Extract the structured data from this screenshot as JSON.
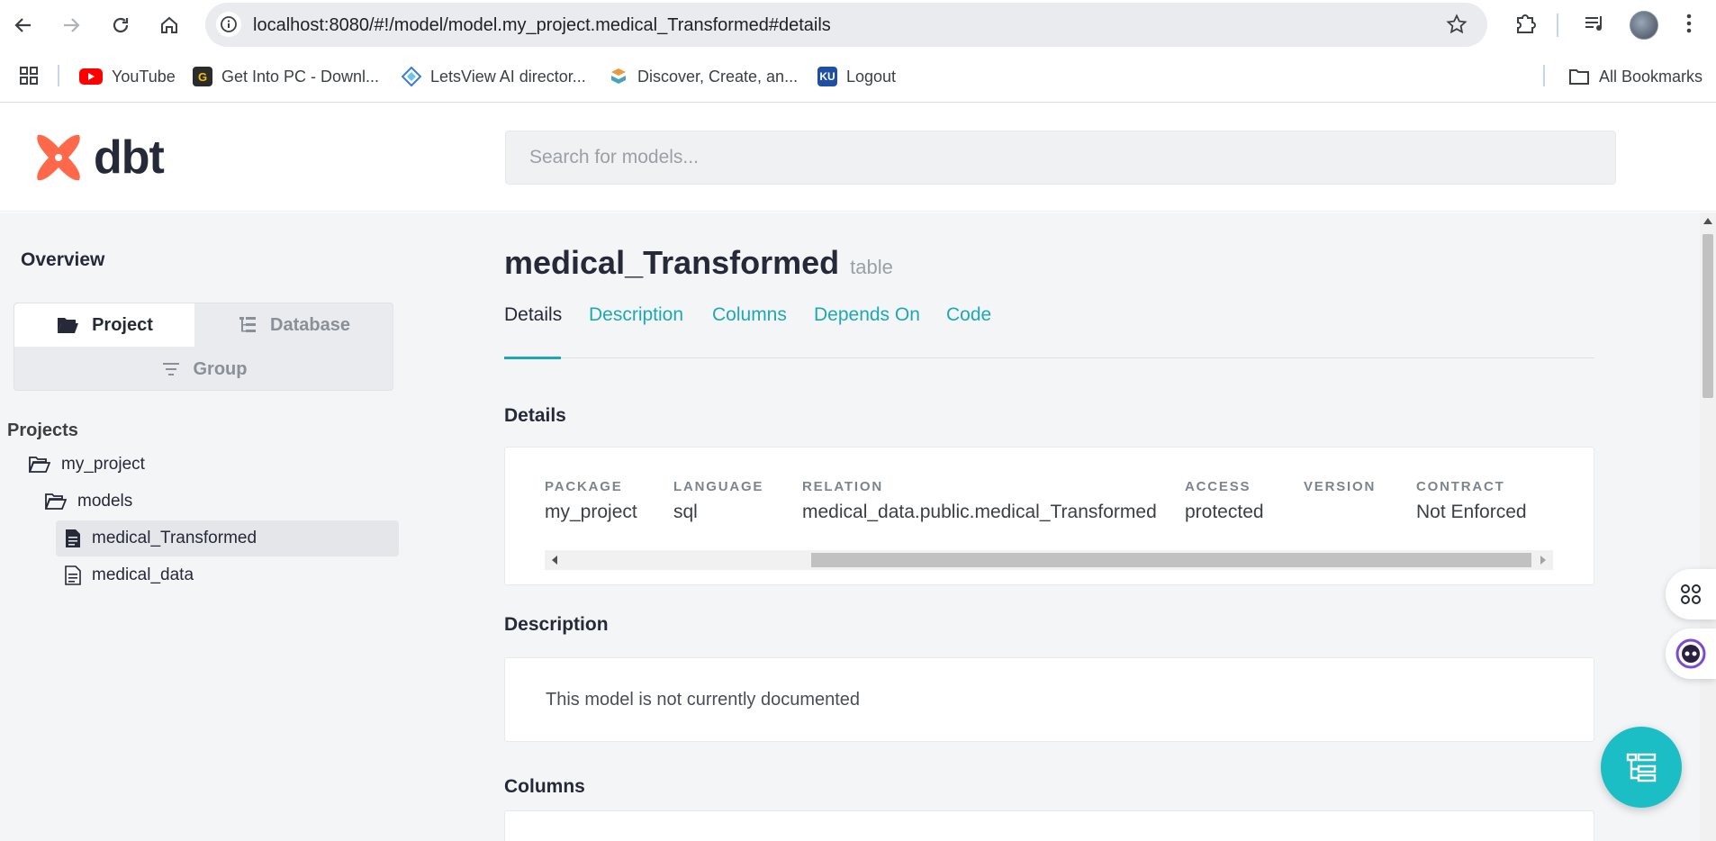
{
  "browser": {
    "url": "localhost:8080/#!/model/model.my_project.medical_Transformed#details",
    "bookmarks": [
      {
        "label": "YouTube",
        "icon": "youtube-icon"
      },
      {
        "label": "Get Into PC - Downl...",
        "icon": "getintopc-icon"
      },
      {
        "label": "LetsView AI director...",
        "icon": "letsview-icon"
      },
      {
        "label": "Discover, Create, an...",
        "icon": "discover-icon"
      },
      {
        "label": "Logout",
        "icon": "ku-icon",
        "icon_text": "KU"
      }
    ],
    "all_bookmarks": "All Bookmarks"
  },
  "app": {
    "logo_text": "dbt",
    "search_placeholder": "Search for models...",
    "accent_color": "#1da8b4",
    "brand_color": "#ff694a"
  },
  "sidebar": {
    "overview": "Overview",
    "tabs": {
      "project": "Project",
      "database": "Database",
      "group": "Group"
    },
    "active_tab": "Project",
    "projects_label": "Projects",
    "tree": {
      "project": "my_project",
      "folder": "models",
      "items": [
        {
          "label": "medical_Transformed",
          "selected": true
        },
        {
          "label": "medical_data",
          "selected": false
        }
      ]
    }
  },
  "model": {
    "name": "medical_Transformed",
    "kind": "table",
    "tabs": [
      "Details",
      "Description",
      "Columns",
      "Depends On",
      "Code"
    ],
    "active_tab": "Details",
    "details_title": "Details",
    "details": [
      {
        "key": "PACKAGE",
        "value": "my_project"
      },
      {
        "key": "LANGUAGE",
        "value": "sql"
      },
      {
        "key": "RELATION",
        "value": "medical_data.public.medical_Transformed"
      },
      {
        "key": "ACCESS",
        "value": "protected"
      },
      {
        "key": "VERSION",
        "value": ""
      },
      {
        "key": "CONTRACT",
        "value": "Not Enforced"
      }
    ],
    "description_title": "Description",
    "description_text": "This model is not currently documented",
    "columns_title": "Columns"
  }
}
